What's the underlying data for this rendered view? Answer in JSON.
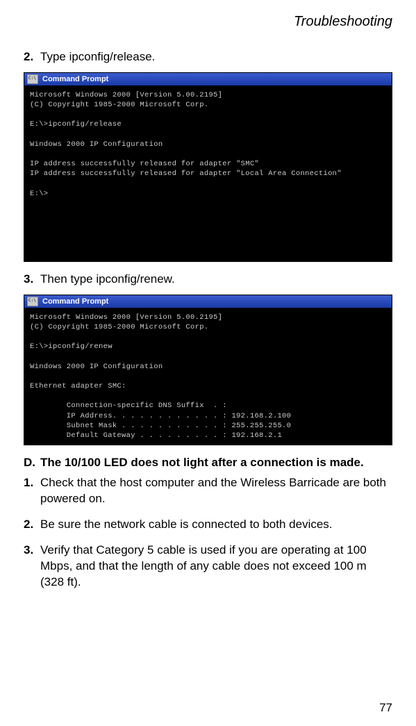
{
  "header": "Troubleshooting",
  "step2": {
    "num": "2.",
    "text": "Type ipconfig/release."
  },
  "cmd1": {
    "title": "Command Prompt",
    "line1": "Microsoft Windows 2000 [Version 5.00.2195]",
    "line2": "(C) Copyright 1985-2000 Microsoft Corp.",
    "line3": "E:\\>ipconfig/release",
    "line4": "Windows 2000 IP Configuration",
    "line5": "IP address successfully released for adapter \"SMC\"",
    "line6": "IP address successfully released for adapter \"Local Area Connection\"",
    "line7": "E:\\>"
  },
  "step3": {
    "num": "3.",
    "text": "Then type ipconfig/renew."
  },
  "cmd2": {
    "title": "Command Prompt",
    "line1": "Microsoft Windows 2000 [Version 5.00.2195]",
    "line2": "(C) Copyright 1985-2000 Microsoft Corp.",
    "line3": "E:\\>ipconfig/renew",
    "line4": "Windows 2000 IP Configuration",
    "line5": "Ethernet adapter SMC:",
    "line6": "        Connection-specific DNS Suffix  . :",
    "line7": "        IP Address. . . . . . . . . . . . : 192.168.2.100",
    "line8": "        Subnet Mask . . . . . . . . . . . : 255.255.255.0",
    "line9": "        Default Gateway . . . . . . . . . : 192.168.2.1"
  },
  "sectionD": {
    "letter": "D.",
    "text": "The 10/100 LED does not light after a connection is made."
  },
  "d_step1": {
    "num": "1.",
    "text": "Check that the host computer and the Wireless Barricade are both powered on."
  },
  "d_step2": {
    "num": "2.",
    "text": "Be sure the network cable is connected to both devices."
  },
  "d_step3": {
    "num": "3.",
    "text": "Verify that Category 5 cable is used if you are operating at 100 Mbps, and that the length of any cable does not exceed 100 m (328 ft)."
  },
  "pageNumber": "77"
}
